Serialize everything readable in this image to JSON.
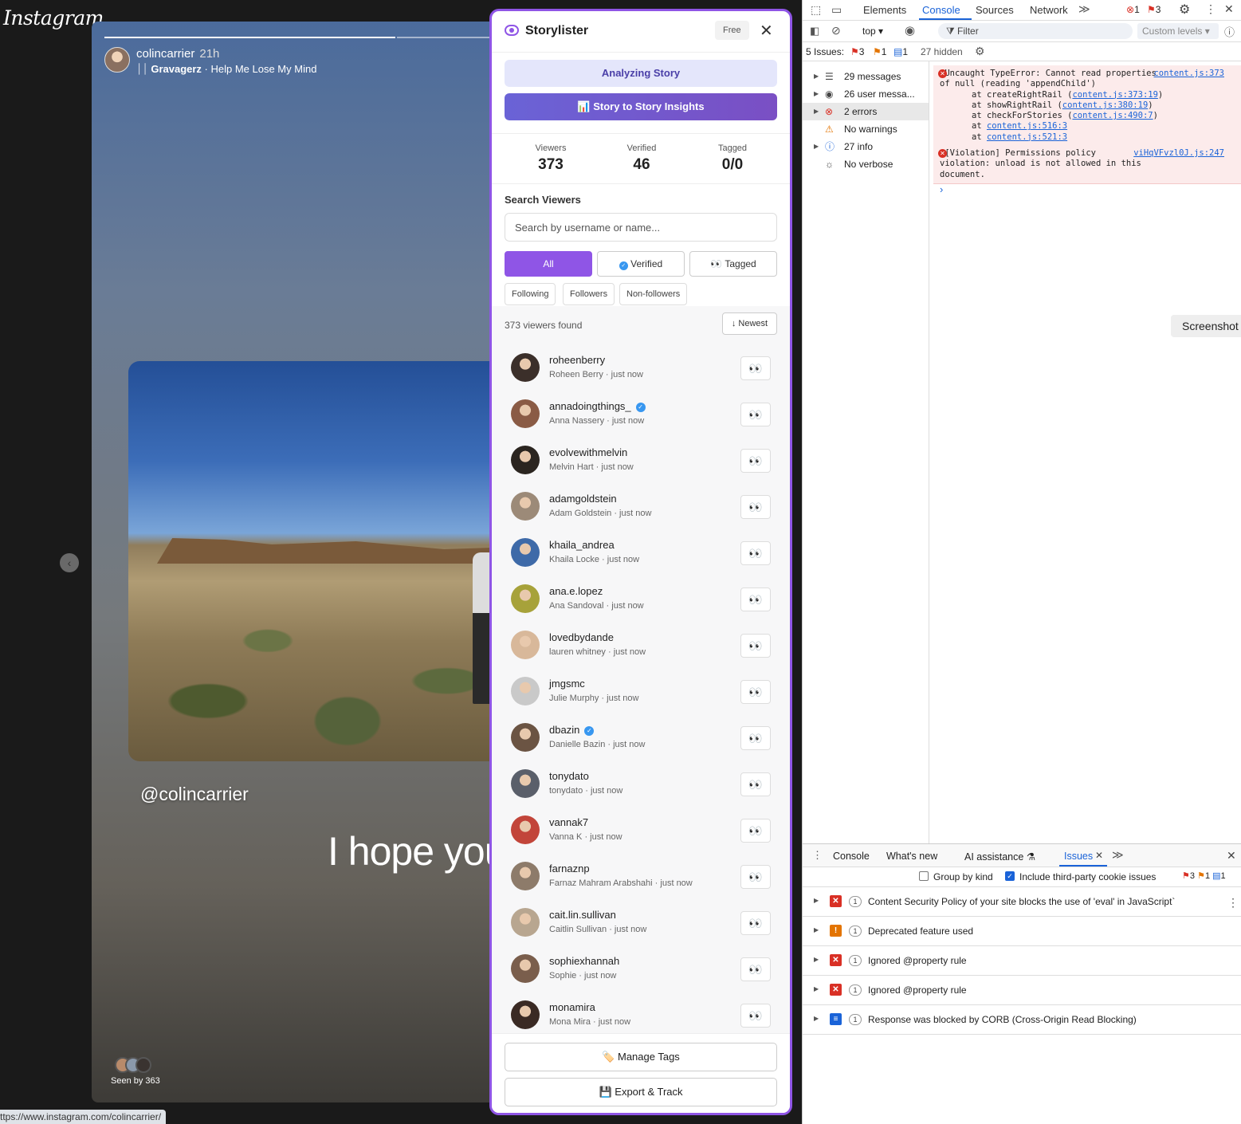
{
  "instagram": {
    "logo": "Instagram",
    "story_username": "colincarrier",
    "story_time": "21h",
    "music_artist": "Gravagerz",
    "music_title": "· Help Me Lose My Mind",
    "mention": "@colincarrier",
    "caption": "I hope you c",
    "seen_by": "Seen by 363",
    "status_url": "ttps://www.instagram.com/colincarrier/"
  },
  "panel": {
    "title": "Storylister",
    "plan_badge": "Free",
    "analyzing_label": "Analyzing Story",
    "insights_label": "📊 Story to Story Insights",
    "stats": [
      {
        "label": "Viewers",
        "value": "373"
      },
      {
        "label": "Verified",
        "value": "46"
      },
      {
        "label": "Tagged",
        "value": "0/0"
      }
    ],
    "search_label": "Search Viewers",
    "search_placeholder": "Search by username or name...",
    "filters": {
      "all": "All",
      "verified": "Verified",
      "tagged": "👀 Tagged"
    },
    "subfilters": {
      "following": "Following",
      "followers": "Followers",
      "non_followers": "Non-followers"
    },
    "found_text": "373 viewers found",
    "sort_label": "↓ Newest",
    "viewers": [
      {
        "username": "roheenberry",
        "name": "Roheen Berry · just now",
        "verified": false,
        "color": "#3b2f2a"
      },
      {
        "username": "annadoingthings_",
        "name": "Anna Nassery · just now",
        "verified": true,
        "color": "#8a5b45"
      },
      {
        "username": "evolvewithmelvin",
        "name": "Melvin Hart · just now",
        "verified": false,
        "color": "#2b2520"
      },
      {
        "username": "adamgoldstein",
        "name": "Adam Goldstein · just now",
        "verified": false,
        "color": "#9c8a78"
      },
      {
        "username": "khaila_andrea",
        "name": "Khaila Locke · just now",
        "verified": false,
        "color": "#3e6aa8"
      },
      {
        "username": "ana.e.lopez",
        "name": "Ana Sandoval · just now",
        "verified": false,
        "color": "#a7a23a"
      },
      {
        "username": "lovedbydande",
        "name": "lauren whitney · just now",
        "verified": false,
        "color": "#d8b89a"
      },
      {
        "username": "jmgsmc",
        "name": "Julie Murphy · just now",
        "verified": false,
        "color": "#c9c9c9"
      },
      {
        "username": "dbazin",
        "name": "Danielle Bazin · just now",
        "verified": true,
        "color": "#6b5443"
      },
      {
        "username": "tonydato",
        "name": "tonydato · just now",
        "verified": false,
        "color": "#5a5f6a"
      },
      {
        "username": "vannak7",
        "name": "Vanna K · just now",
        "verified": false,
        "color": "#c2453a"
      },
      {
        "username": "farnaznp",
        "name": "Farnaz Mahram Arabshahi · just now",
        "verified": false,
        "color": "#8d7b6a"
      },
      {
        "username": "cait.lin.sullivan",
        "name": "Caitlin Sullivan · just now",
        "verified": false,
        "color": "#b8a690"
      },
      {
        "username": "sophiexhannah",
        "name": "Sophie · just now",
        "verified": false,
        "color": "#7a5e4c"
      },
      {
        "username": "monamira",
        "name": "Mona Mira · just now",
        "verified": false,
        "color": "#3a2a24"
      }
    ],
    "eyes": "👀",
    "manage_tags": "🏷️ Manage Tags",
    "export_track": "💾 Export & Track",
    "accent_color": "#8f55e6"
  },
  "devtools": {
    "tabs": [
      "Elements",
      "Console",
      "Sources",
      "Network"
    ],
    "error_count": "1",
    "issue_count": "3",
    "context": "top ▾",
    "filter_placeholder": "Filter",
    "levels": "Custom levels ▾",
    "issues_summary": "5 Issues:",
    "issues_counts": {
      "error": "3",
      "warning": "1",
      "info": "1"
    },
    "hidden": "27 hidden",
    "sidebar": [
      {
        "label": "29 messages",
        "icon": "list-icon",
        "glyph": "☰",
        "arrow": true
      },
      {
        "label": "26 user messa...",
        "icon": "user-icon",
        "glyph": "◉",
        "arrow": true
      },
      {
        "label": "2 errors",
        "icon": "error-icon",
        "glyph": "⊗",
        "arrow": true
      },
      {
        "label": "No warnings",
        "icon": "warning-icon",
        "glyph": "⚠",
        "arrow": false
      },
      {
        "label": "27 info",
        "icon": "info-icon",
        "glyph": "ⓘ",
        "arrow": true
      },
      {
        "label": "No verbose",
        "icon": "bug-icon",
        "glyph": "☼",
        "arrow": false
      }
    ],
    "error1": {
      "message": "▶Uncaught TypeError: Cannot read properties of null (reading 'appendChild')",
      "source": "content.js:373",
      "stack": [
        {
          "text": "at createRightRail (",
          "link": "content.js:373:19",
          "end": ")"
        },
        {
          "text": "at showRightRail (",
          "link": "content.js:380:19",
          "end": ")"
        },
        {
          "text": "at checkForStories (",
          "link": "content.js:490:7",
          "end": ")"
        },
        {
          "text": "at ",
          "link": "content.js:516:3",
          "end": ""
        },
        {
          "text": "at ",
          "link": "content.js:521:3",
          "end": ""
        }
      ]
    },
    "error2": {
      "message": "▶[Violation] Permissions policy violation: unload is not allowed in this document.",
      "source": "viHqVFvzl0J.js:247"
    },
    "screenshot_tip": "Screenshot",
    "drawer_tabs": [
      "Console",
      "What's new",
      "AI assistance ⚗",
      "Issues"
    ],
    "group_by_kind": "Group by kind",
    "include_third_party": "Include third-party cookie issues",
    "issues": [
      {
        "label": "Content Security Policy of your site blocks the use of 'eval' in JavaScript`",
        "type": "error",
        "count": "1"
      },
      {
        "label": "Deprecated feature used",
        "type": "warning",
        "count": "1"
      },
      {
        "label": "Ignored @property rule",
        "type": "error",
        "count": "1"
      },
      {
        "label": "Ignored @property rule",
        "type": "error",
        "count": "1"
      },
      {
        "label": "Response was blocked by CORB (Cross-Origin Read Blocking)",
        "type": "info",
        "count": "1"
      }
    ]
  }
}
